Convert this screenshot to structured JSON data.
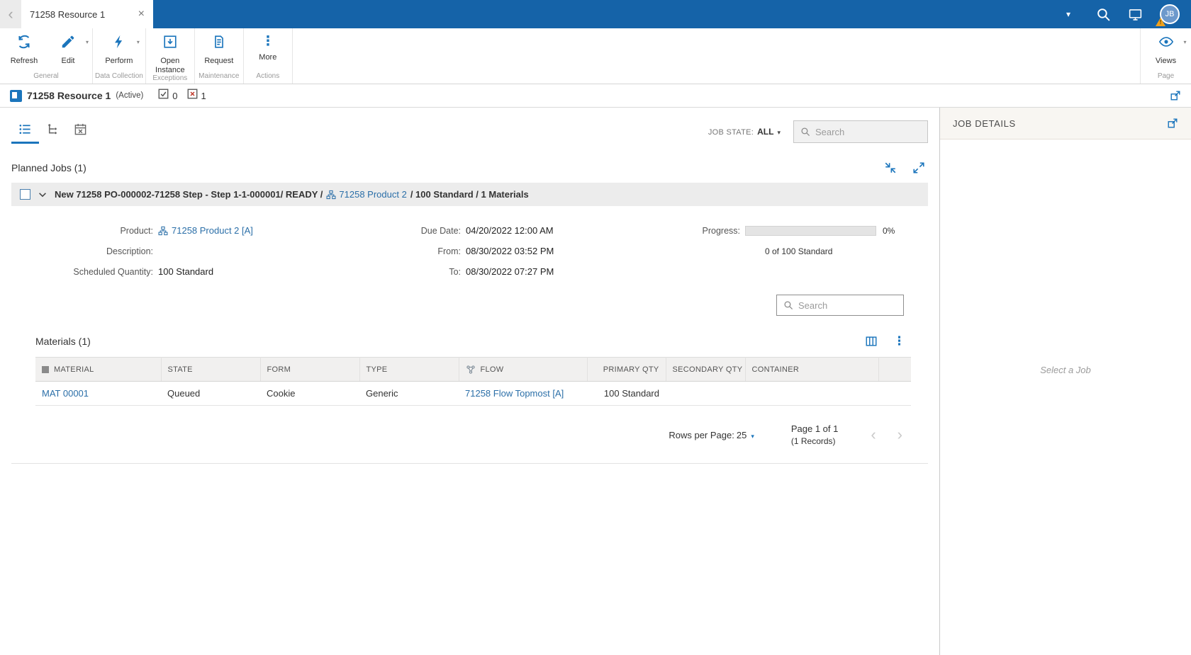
{
  "colors": {
    "topbar_blue": "#1563a8",
    "icon_blue": "#1b75bc",
    "link_blue": "#2b6fa8",
    "warning_orange": "#f0a11c",
    "error_red": "#c0392b",
    "selected_tab_underline": "#1b75bc"
  },
  "icons": {
    "back_chevron": "‹",
    "close": "×",
    "caret_down": "▾",
    "ellipsis_vertical": "⋮",
    "prev_chevron": "‹",
    "next_chevron": "›"
  },
  "topbar": {
    "tab_title": "71258 Resource 1",
    "avatar_initials": "JB",
    "warning_mark": "!"
  },
  "ribbon": {
    "refresh_label": "Refresh",
    "edit_label": "Edit",
    "perform_label": "Perform",
    "open_instance_label": "Open Instance",
    "request_label": "Request",
    "more_label": "More",
    "views_label": "Views",
    "group_general": "General",
    "group_data_collection": "Data Collection",
    "group_exceptions": "Exceptions",
    "group_maintenance": "Maintenance",
    "group_actions": "Actions",
    "group_page": "Page"
  },
  "titlebar": {
    "title": "71258 Resource 1",
    "status": "(Active)",
    "ok_count": "0",
    "error_count": "1"
  },
  "toolbar": {
    "job_state_label": "JOB STATE:",
    "job_state_value": "ALL",
    "search_placeholder": "Search"
  },
  "planned_jobs": {
    "heading": "Planned Jobs (1)",
    "job": {
      "title_prefix": "New 71258 PO-000002-71258 Step - Step 1-1-000001/ READY /",
      "product_link": "71258 Product 2",
      "title_suffix": "/ 100 Standard / 1 Materials",
      "product_label": "Product:",
      "product_value": "71258 Product 2 [A]",
      "description_label": "Description:",
      "description_value": "",
      "scheduled_qty_label": "Scheduled Quantity:",
      "scheduled_qty_value": "100 Standard",
      "due_date_label": "Due Date:",
      "due_date_value": "04/20/2022 12:00 AM",
      "from_label": "From:",
      "from_value": "08/30/2022 03:52 PM",
      "to_label": "To:",
      "to_value": "08/30/2022 07:27 PM",
      "progress_label": "Progress:",
      "progress_value": 0,
      "progress_percent": "0%",
      "progress_caption": "0 of 100 Standard"
    }
  },
  "materials": {
    "heading": "Materials (1)",
    "search_placeholder": "Search",
    "columns": {
      "material": "MATERIAL",
      "state": "STATE",
      "form": "FORM",
      "type": "TYPE",
      "flow": "FLOW",
      "primary_qty": "PRIMARY QTY",
      "secondary_qty": "SECONDARY QTY",
      "container": "CONTAINER"
    },
    "rows": [
      {
        "material": "MAT 00001",
        "state": "Queued",
        "form": "Cookie",
        "type": "Generic",
        "flow": "71258 Flow Topmost [A]",
        "primary_qty": "100 Standard",
        "secondary_qty": "",
        "container": ""
      }
    ],
    "pagination": {
      "rows_per_page_label": "Rows per Page:",
      "rows_per_page_value": "25",
      "page_info": "Page 1 of 1",
      "records_info": "(1 Records)"
    }
  },
  "job_details_panel": {
    "title": "JOB DETAILS",
    "empty_text": "Select a Job"
  }
}
